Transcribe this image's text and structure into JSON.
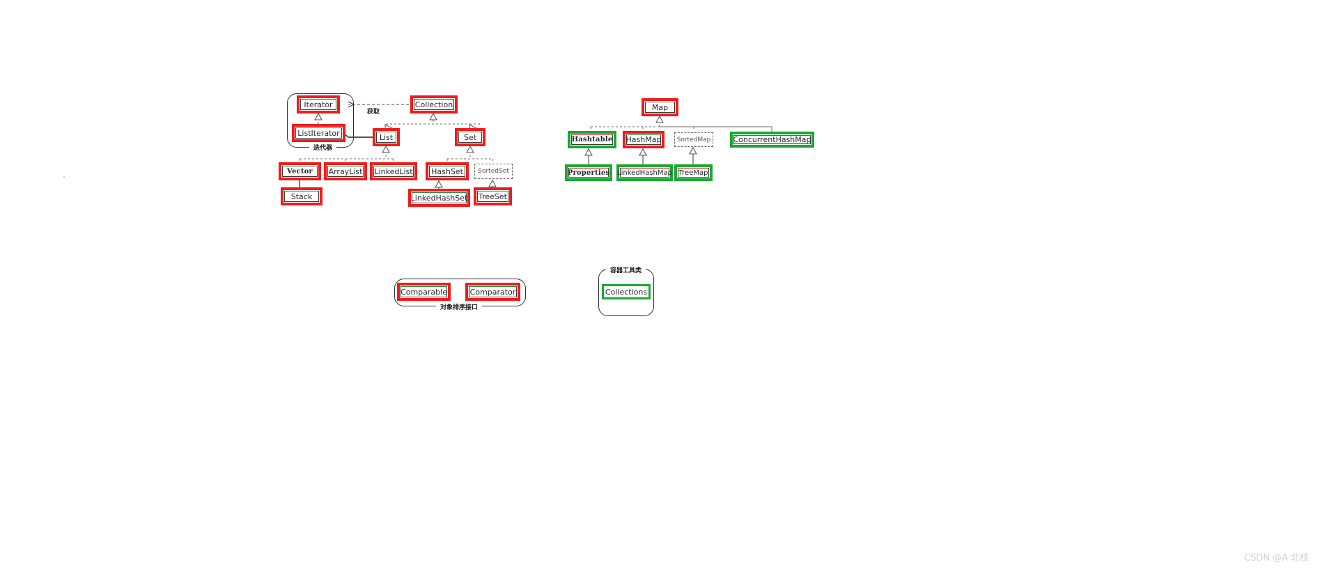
{
  "page": {
    "background_color": "#ffffff",
    "watermark": "CSDN @A 北枝"
  },
  "colors": {
    "highlight_red": "#f01c1c",
    "highlight_green": "#1aa832",
    "box_border": "#3a3a3a",
    "interface_border_dashed": "#6b6b6b",
    "text": "#24292e",
    "watermark": "#d3d3d3"
  },
  "diagrams": {
    "collection": {
      "iterator_panel": {
        "title": "迭代器",
        "nodes": {
          "iterator": "Iterator",
          "list_iterator": "ListIterator"
        }
      },
      "edge_labels": {
        "obtain": "获取"
      },
      "nodes": {
        "collection": "Collection",
        "list": "List",
        "set": "Set",
        "vector": "Vector",
        "array_list": "ArrayList",
        "linked_list": "LinkedList",
        "stack": "Stack",
        "hash_set": "HashSet",
        "sorted_set": "SortedSet",
        "linked_hash_set": "LinkedHashSet",
        "tree_set": "TreeSet"
      }
    },
    "map": {
      "nodes": {
        "map": "Map",
        "hashtable": "Hashtable",
        "hash_map": "HashMap",
        "sorted_map": "SortedMap",
        "concurrent_hash_map": "ConcurrentHashMap",
        "properties": "Properties",
        "linked_hash_map": "LinkedHashMap",
        "tree_map": "TreeMap"
      }
    },
    "sorting_panel": {
      "title": "对象排序接口",
      "nodes": {
        "comparable": "Comparable",
        "comparator": "Comparator"
      }
    },
    "utility_panel": {
      "title": "容器工具类",
      "nodes": {
        "collections": "Collections"
      }
    }
  }
}
